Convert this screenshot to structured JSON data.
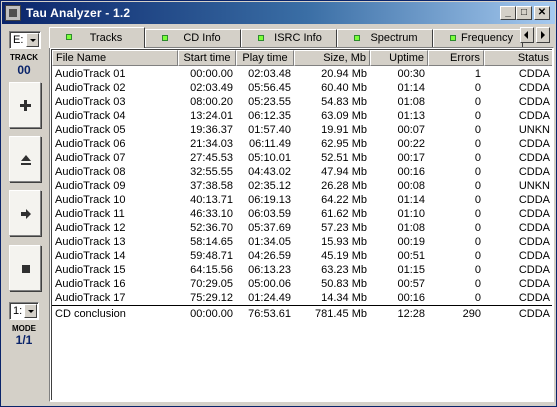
{
  "window": {
    "title": "Tau Analyzer - 1.2",
    "caption_min": "_",
    "caption_max": "□",
    "caption_close": "✕"
  },
  "left_panel": {
    "drive_value": "E:",
    "track_label": "TRACK",
    "track_value": "00",
    "mode_select_value": "1:",
    "mode_label": "MODE",
    "mode_value": "1/1",
    "buttons": [
      {
        "name": "add-icon"
      },
      {
        "name": "eject-icon"
      },
      {
        "name": "play-icon"
      },
      {
        "name": "stop-icon"
      }
    ]
  },
  "tabs": [
    {
      "label": "Tracks",
      "active": true
    },
    {
      "label": "CD Info",
      "active": false
    },
    {
      "label": "ISRC Info",
      "active": false
    },
    {
      "label": "Spectrum",
      "active": false
    },
    {
      "label": "Frequency",
      "active": false
    }
  ],
  "table": {
    "columns": [
      "File Name",
      "Start time",
      "Play time",
      "Size, Mb",
      "Uptime",
      "Errors",
      "Status"
    ],
    "rows": [
      [
        "AudioTrack 01",
        "00:00.00",
        "02:03.48",
        "20.94 Mb",
        "00:30",
        "1",
        "CDDA"
      ],
      [
        "AudioTrack 02",
        "02:03.49",
        "05:56.45",
        "60.40 Mb",
        "01:14",
        "0",
        "CDDA"
      ],
      [
        "AudioTrack 03",
        "08:00.20",
        "05:23.55",
        "54.83 Mb",
        "01:08",
        "0",
        "CDDA"
      ],
      [
        "AudioTrack 04",
        "13:24.01",
        "06:12.35",
        "63.09 Mb",
        "01:13",
        "0",
        "CDDA"
      ],
      [
        "AudioTrack 05",
        "19:36.37",
        "01:57.40",
        "19.91 Mb",
        "00:07",
        "0",
        "UNKN"
      ],
      [
        "AudioTrack 06",
        "21:34.03",
        "06:11.49",
        "62.95 Mb",
        "00:22",
        "0",
        "CDDA"
      ],
      [
        "AudioTrack 07",
        "27:45.53",
        "05:10.01",
        "52.51 Mb",
        "00:17",
        "0",
        "CDDA"
      ],
      [
        "AudioTrack 08",
        "32:55.55",
        "04:43.02",
        "47.94 Mb",
        "00:16",
        "0",
        "CDDA"
      ],
      [
        "AudioTrack 09",
        "37:38.58",
        "02:35.12",
        "26.28 Mb",
        "00:08",
        "0",
        "UNKN"
      ],
      [
        "AudioTrack 10",
        "40:13.71",
        "06:19.13",
        "64.22 Mb",
        "01:14",
        "0",
        "CDDA"
      ],
      [
        "AudioTrack 11",
        "46:33.10",
        "06:03.59",
        "61.62 Mb",
        "01:10",
        "0",
        "CDDA"
      ],
      [
        "AudioTrack 12",
        "52:36.70",
        "05:37.69",
        "57.23 Mb",
        "01:08",
        "0",
        "CDDA"
      ],
      [
        "AudioTrack 13",
        "58:14.65",
        "01:34.05",
        "15.93 Mb",
        "00:19",
        "0",
        "CDDA"
      ],
      [
        "AudioTrack 14",
        "59:48.71",
        "04:26.59",
        "45.19 Mb",
        "00:51",
        "0",
        "CDDA"
      ],
      [
        "AudioTrack 15",
        "64:15.56",
        "06:13.23",
        "63.23 Mb",
        "01:15",
        "0",
        "CDDA"
      ],
      [
        "AudioTrack 16",
        "70:29.05",
        "05:00.06",
        "50.83 Mb",
        "00:57",
        "0",
        "CDDA"
      ],
      [
        "AudioTrack 17",
        "75:29.12",
        "01:24.49",
        "14.34 Mb",
        "00:16",
        "0",
        "CDDA"
      ]
    ],
    "conclusion": [
      "CD conclusion",
      "00:00.00",
      "76:53.61",
      "781.45 Mb",
      "12:28",
      "290",
      "CDDA"
    ]
  },
  "colors": {
    "title_start": "#0a246a",
    "title_end": "#a6caf0",
    "face": "#d4d0c8",
    "tab_led": "#7cff3c",
    "track_value": "#0a246a"
  }
}
